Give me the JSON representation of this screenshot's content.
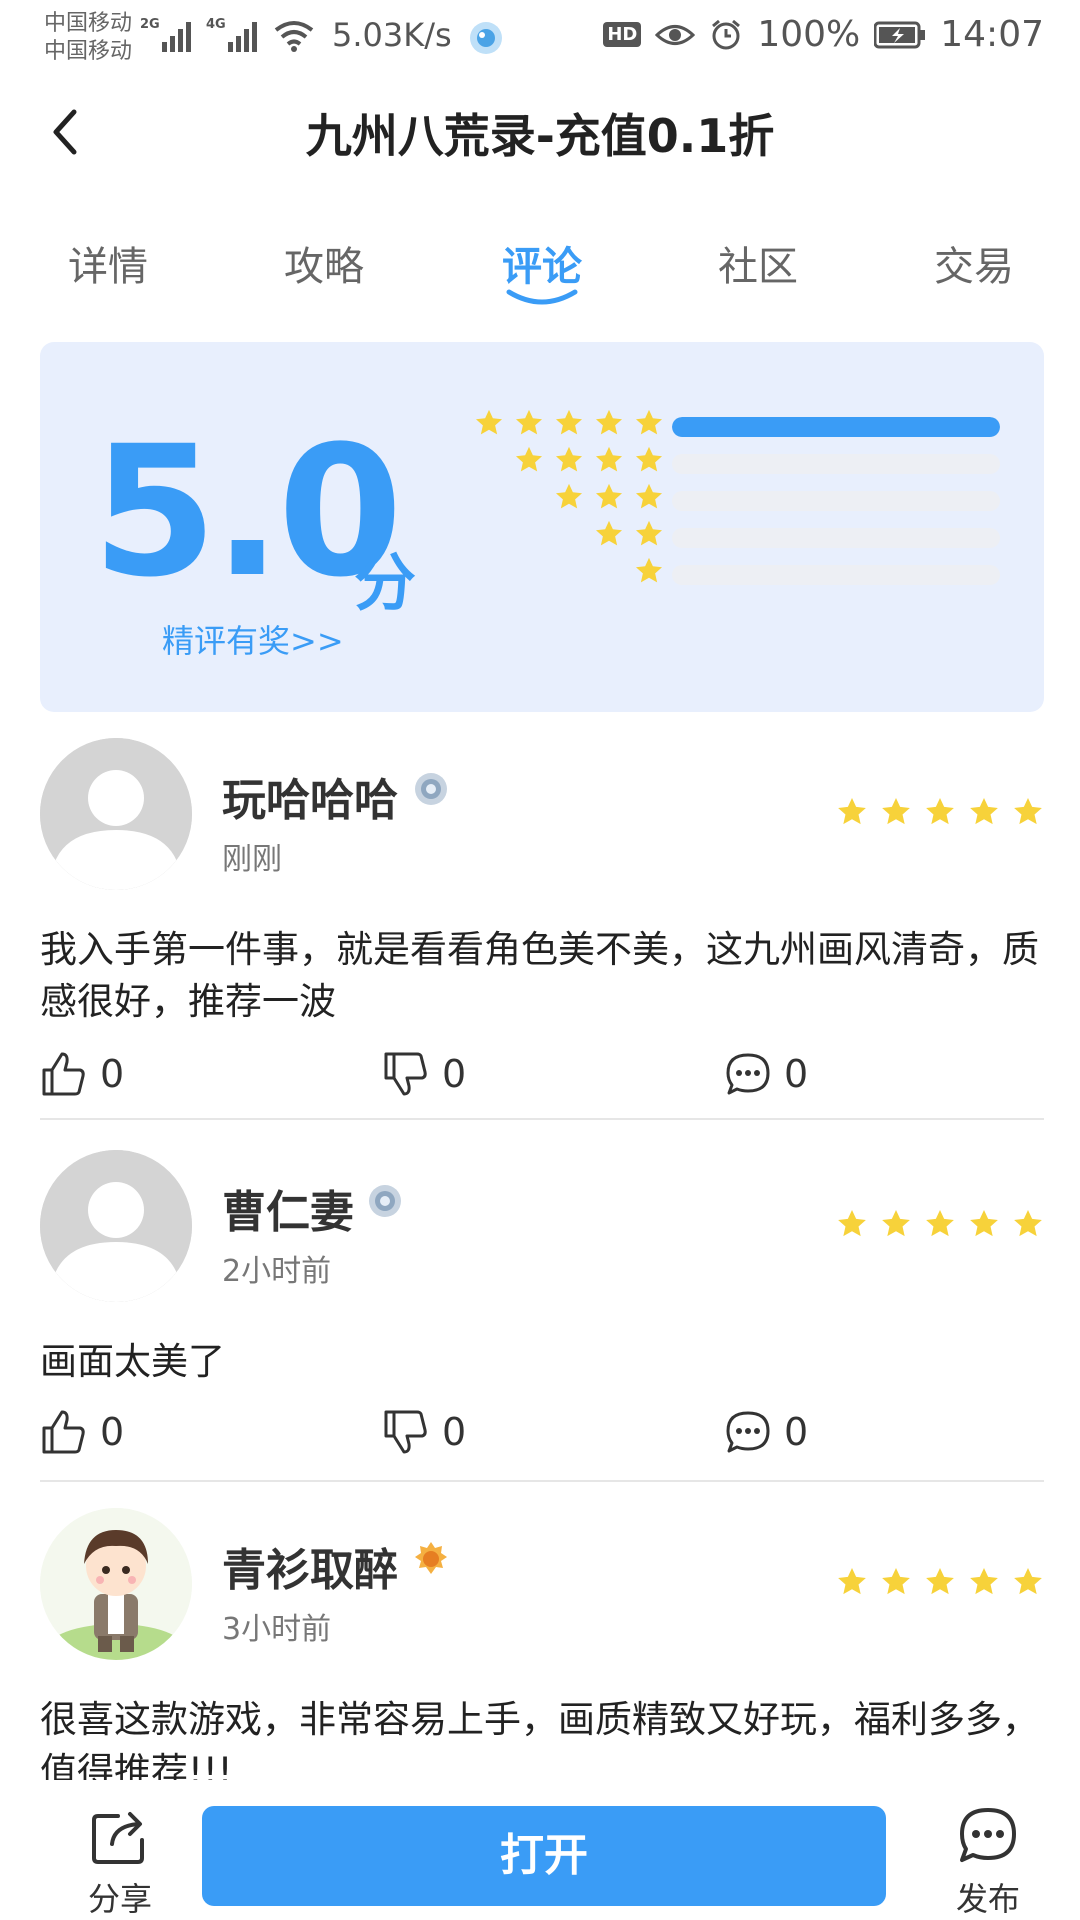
{
  "status_bar": {
    "carrier_1": "中国移动",
    "carrier_2": "中国移动",
    "network_1": "2G",
    "network_2": "4G",
    "net_speed": "5.03K/s",
    "hd": "HD",
    "battery": "100%",
    "time": "14:07"
  },
  "header": {
    "title": "九州八荒录-充值0.1折"
  },
  "tabs": [
    {
      "label": "详情"
    },
    {
      "label": "攻略"
    },
    {
      "label": "评论"
    },
    {
      "label": "社区"
    },
    {
      "label": "交易"
    }
  ],
  "active_tab": "评论",
  "rating": {
    "score": "5.0",
    "unit": "分",
    "reward_link": "精评有奖>>",
    "distribution": [
      {
        "stars": 5,
        "fraction": 1.0
      },
      {
        "stars": 4,
        "fraction": 0.0
      },
      {
        "stars": 3,
        "fraction": 0.0
      },
      {
        "stars": 2,
        "fraction": 0.0
      },
      {
        "stars": 1,
        "fraction": 0.0
      }
    ]
  },
  "reviews": [
    {
      "username": "玩哈哈哈",
      "time": "刚刚",
      "stars": 5,
      "content": "我入手第一件事，就是看看角色美不美，这九州画风清奇，质感很好，推荐一波",
      "likes": "0",
      "dislikes": "0",
      "comments": "0"
    },
    {
      "username": "曹仁妻",
      "time": "2小时前",
      "stars": 5,
      "content": "画面太美了",
      "likes": "0",
      "dislikes": "0",
      "comments": "0"
    },
    {
      "username": "青衫取醉",
      "time": "3小时前",
      "stars": 5,
      "content": "很喜这款游戏，非常容易上手，画质精致又好玩，福利多多，值得推荐!!!"
    }
  ],
  "bottom_bar": {
    "share_label": "分享",
    "open_label": "打开",
    "post_label": "发布"
  },
  "colors": {
    "accent": "#3a9cf6",
    "star": "#f7d23a",
    "card_bg": "#e8effd"
  }
}
